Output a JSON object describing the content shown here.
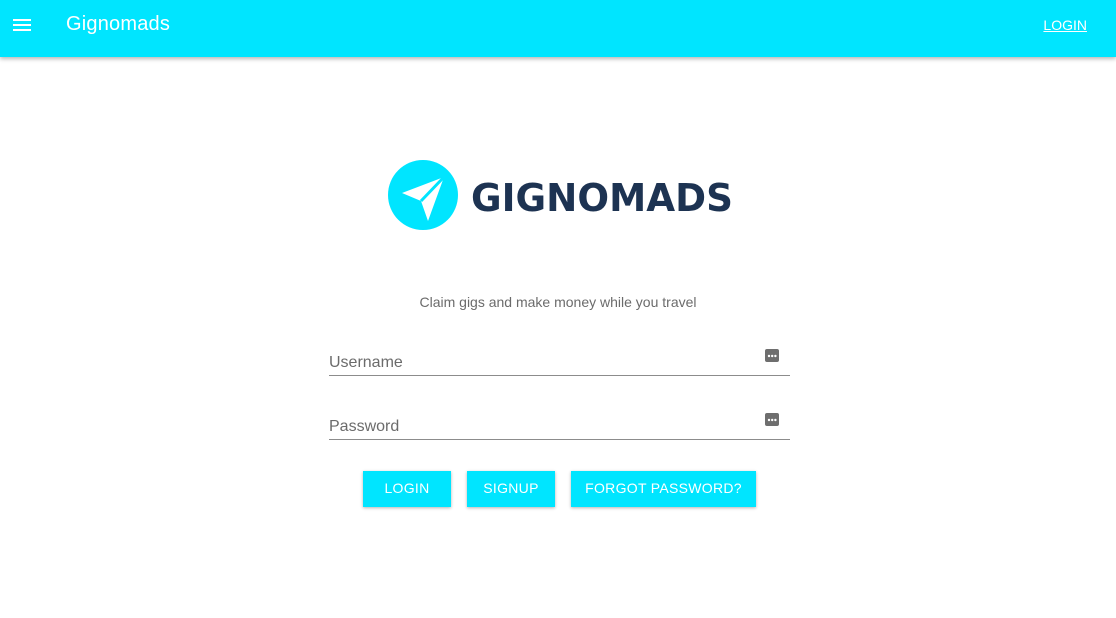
{
  "app": {
    "title": "Gignomads",
    "top_login_label": "LOGIN",
    "brand_color": "#00e5ff"
  },
  "icons": {
    "menu": "menu-icon",
    "logo_mark": "paper-plane-icon",
    "field_dots": "more-horiz-icon"
  },
  "logo": {
    "wordmark": "GIGNOMADS",
    "wordmark_color": "#1d3352"
  },
  "tagline": "Claim gigs and make money while you travel",
  "form": {
    "username_placeholder": "Username",
    "password_placeholder": "Password"
  },
  "buttons": {
    "login": "LOGIN",
    "signup": "SIGNUP",
    "forgot": "FORGOT PASSWORD?"
  }
}
